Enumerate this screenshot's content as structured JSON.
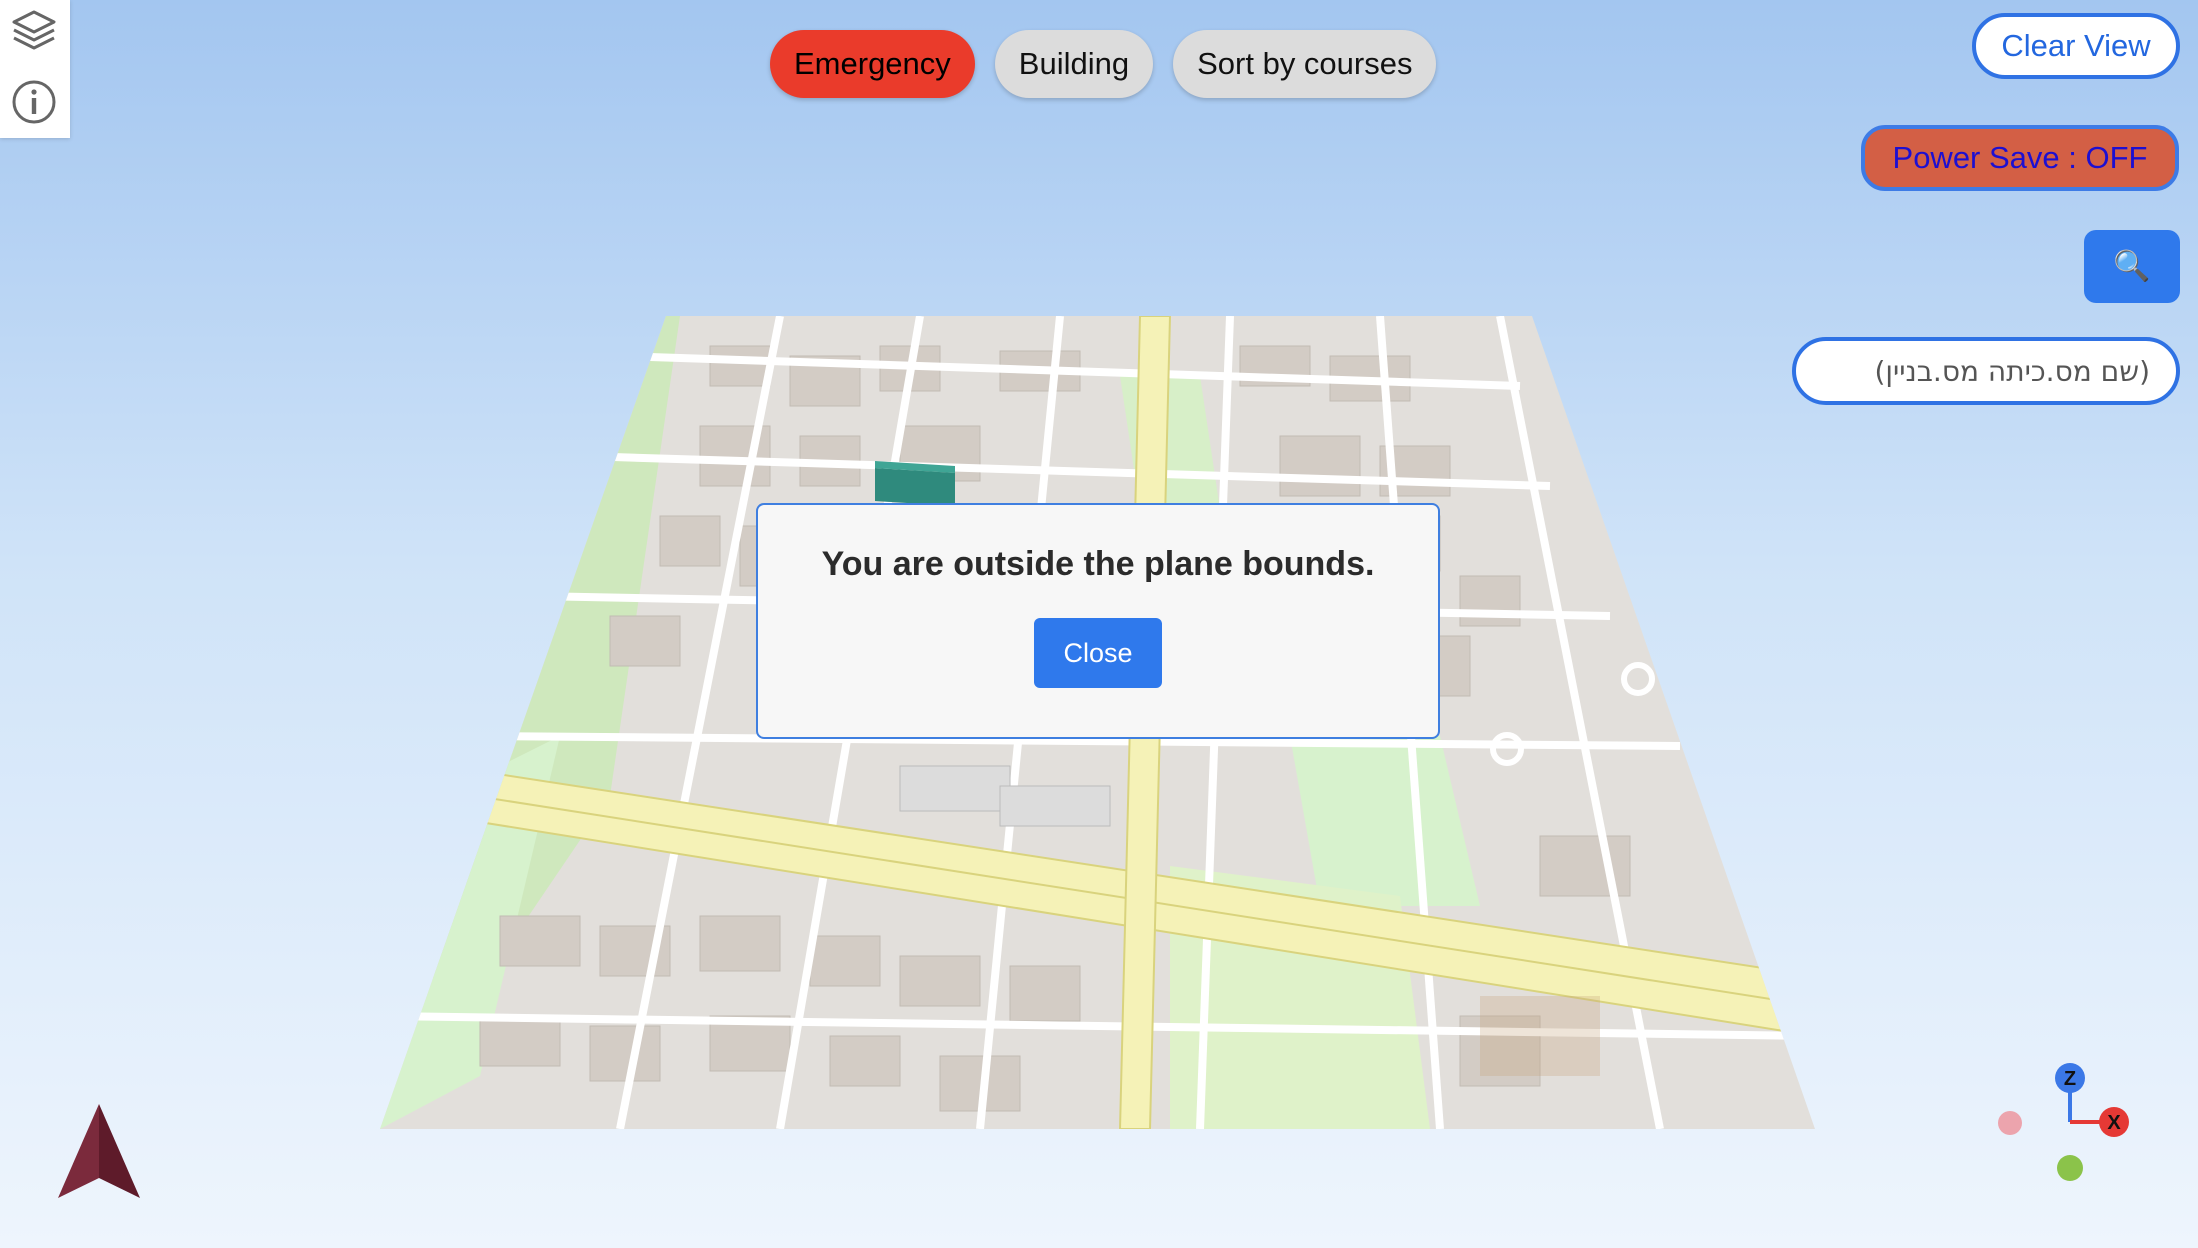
{
  "toolbar": {
    "emergency_label": "Emergency",
    "building_label": "Building",
    "sort_label": "Sort by courses"
  },
  "side_controls": {
    "clear_view_label": "Clear View",
    "power_save_label": "Power Save : OFF",
    "search_button_icon": "🔍",
    "search_placeholder": "(שם מס.כיתה מס.בניין)"
  },
  "left_panel": {
    "icons": [
      "layers-icon",
      "info-icon"
    ]
  },
  "modal": {
    "message": "You are outside the plane bounds.",
    "close_label": "Close"
  },
  "gizmo": {
    "z_label": "Z",
    "x_label": "X"
  },
  "colors": {
    "emergency": "#ea3b2b",
    "accent": "#2f79ec",
    "power_save_bg": "#d35f45"
  }
}
